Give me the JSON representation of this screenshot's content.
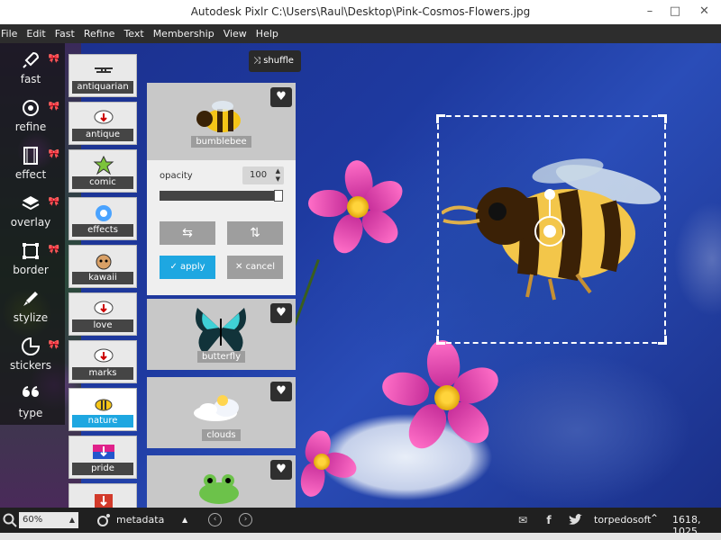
{
  "window": {
    "title": "Autodesk Pixlr   C:\\Users\\Raul\\Desktop\\Pink-Cosmos-Flowers.jpg"
  },
  "menu": [
    "File",
    "Edit",
    "Fast",
    "Refine",
    "Text",
    "Membership",
    "View",
    "Help"
  ],
  "tools": [
    {
      "label": "fast",
      "icon": "rocket-icon"
    },
    {
      "label": "refine",
      "icon": "refine-icon"
    },
    {
      "label": "effect",
      "icon": "film-icon"
    },
    {
      "label": "overlay",
      "icon": "layers-icon"
    },
    {
      "label": "border",
      "icon": "border-icon"
    },
    {
      "label": "stylize",
      "icon": "brush-icon"
    },
    {
      "label": "stickers",
      "icon": "sticker-icon"
    },
    {
      "label": "type",
      "icon": "quote-icon"
    }
  ],
  "categories": [
    {
      "label": "antiquarian"
    },
    {
      "label": "antique"
    },
    {
      "label": "comic"
    },
    {
      "label": "effects"
    },
    {
      "label": "kawaii"
    },
    {
      "label": "love"
    },
    {
      "label": "marks"
    },
    {
      "label": "nature",
      "active": true
    },
    {
      "label": "pride"
    }
  ],
  "shuffle_label": "shuffle",
  "stickers": {
    "selected": "bumblebee",
    "items": [
      "bumblebee",
      "butterfly",
      "clouds"
    ]
  },
  "editor": {
    "opacity_label": "opacity",
    "opacity_value": "100",
    "opacity_fraction": 1.0,
    "apply_label": "apply",
    "cancel_label": "cancel"
  },
  "statusbar": {
    "zoom": "60%",
    "metadata_label": "metadata",
    "user": "torpedosoft",
    "dimensions": "1618, 1025"
  },
  "colors": {
    "accent": "#1ea7e1",
    "bow": "#ff4fa0"
  }
}
